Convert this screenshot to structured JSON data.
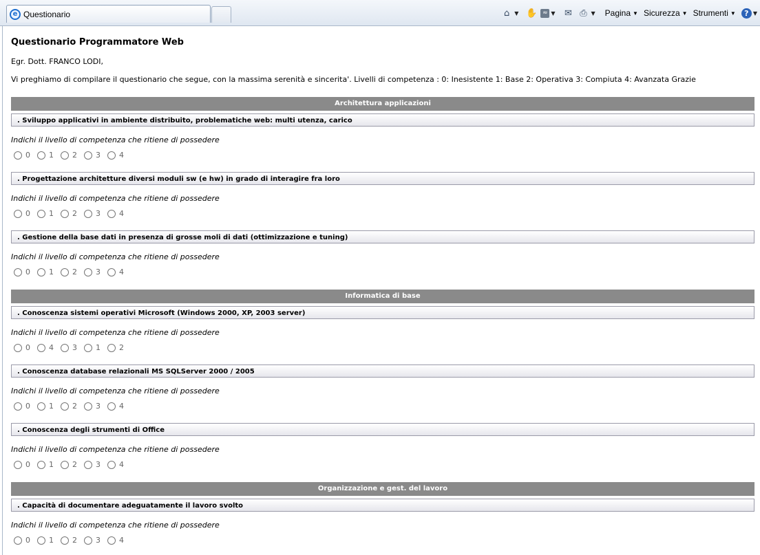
{
  "browser": {
    "tab_title": "Questionario",
    "menus": {
      "pagina": "Pagina",
      "sicurezza": "Sicurezza",
      "strumenti": "Strumenti"
    },
    "help": "?"
  },
  "page": {
    "title": "Questionario Programmatore Web",
    "greeting": "Egr. Dott. FRANCO LODI,",
    "intro": "Vi preghiamo di compilare il questionario che segue, con la massima serenità e sincerita'. Livelli di competenza : 0: Inesistente 1: Base 2: Operativa 3: Compiuta 4: Avanzata Grazie",
    "prompt": "Indichi il livello di competenza che ritiene di possedere"
  },
  "sections": [
    {
      "title": "Architettura applicazioni",
      "questions": [
        {
          "text": ". Sviluppo applicativi in ambiente distribuito, problematiche web: multi utenza, carico",
          "options": [
            "0",
            "1",
            "2",
            "3",
            "4"
          ]
        },
        {
          "text": ". Progettazione architetture diversi moduli sw (e hw) in grado di interagire fra loro",
          "options": [
            "0",
            "1",
            "2",
            "3",
            "4"
          ]
        },
        {
          "text": ". Gestione della base dati in presenza di grosse moli di dati (ottimizzazione e tuning)",
          "options": [
            "0",
            "1",
            "2",
            "3",
            "4"
          ]
        }
      ]
    },
    {
      "title": "Informatica di base",
      "questions": [
        {
          "text": ". Conoscenza sistemi operativi Microsoft (Windows 2000, XP, 2003 server)",
          "options": [
            "0",
            "4",
            "3",
            "1",
            "2"
          ]
        },
        {
          "text": ". Conoscenza database relazionali MS SQLServer 2000 / 2005",
          "options": [
            "0",
            "1",
            "2",
            "3",
            "4"
          ]
        },
        {
          "text": ". Conoscenza degli strumenti di Office",
          "options": [
            "0",
            "1",
            "2",
            "3",
            "4"
          ]
        }
      ]
    },
    {
      "title": "Organizzazione e gest. del lavoro",
      "questions": [
        {
          "text": ". Capacità di documentare adeguatamente il lavoro svolto",
          "options": [
            "0",
            "1",
            "2",
            "3",
            "4"
          ]
        }
      ]
    }
  ]
}
